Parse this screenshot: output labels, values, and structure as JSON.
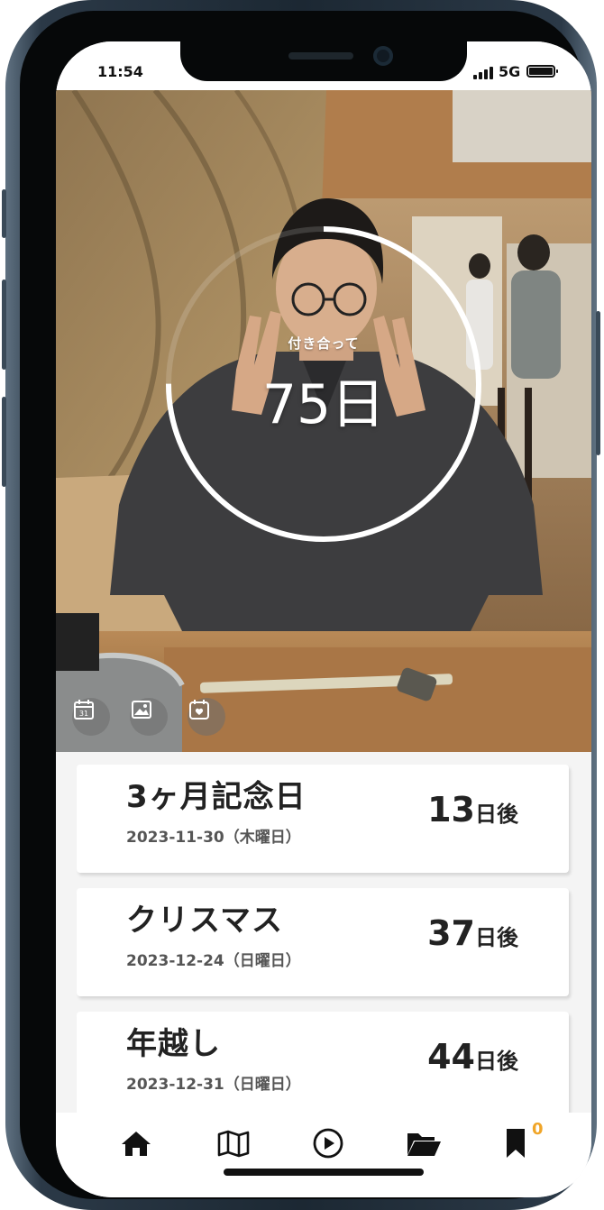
{
  "status_bar": {
    "time": "11:54",
    "network": "5G"
  },
  "hero": {
    "caption": "付き合って",
    "days_value": "75",
    "days_unit": "日",
    "ring_progress": 0.75,
    "buttons": [
      "calendar-icon",
      "image-icon",
      "anniversary-icon"
    ],
    "calendar_icon_text": "31"
  },
  "events": [
    {
      "title": "3ヶ月記念日",
      "date": "2023-11-30（木曜日）",
      "count": "13",
      "unit": "日後"
    },
    {
      "title": "クリスマス",
      "date": "2023-12-24（日曜日）",
      "count": "37",
      "unit": "日後"
    },
    {
      "title": "年越し",
      "date": "2023-12-31（日曜日）",
      "count": "44",
      "unit": "日後"
    }
  ],
  "nav": {
    "items": [
      "home-icon",
      "map-icon",
      "play-icon",
      "folder-icon",
      "bookmark-icon"
    ],
    "bookmark_badge": "0"
  },
  "colors": {
    "badge": "#f0a528",
    "frame": "#1c2833"
  }
}
